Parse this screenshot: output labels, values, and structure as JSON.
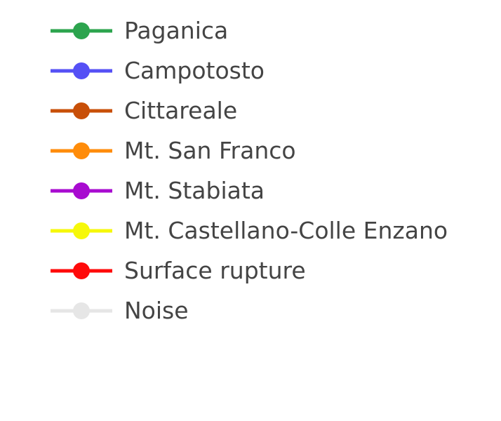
{
  "chart_data": {
    "type": "scatter",
    "legend": [
      {
        "name": "Paganica",
        "color": "#2ca44e"
      },
      {
        "name": "Campotosto",
        "color": "#5550f5"
      },
      {
        "name": "Cittareale",
        "color": "#c84f08"
      },
      {
        "name": "Mt. San Franco",
        "color": "#ff8c0a"
      },
      {
        "name": "Mt. Stabiata",
        "color": "#a80bd0"
      },
      {
        "name": "Mt. Castellano-Colle Enzano",
        "color": "#f6f80a"
      },
      {
        "name": "Surface rupture",
        "color": "#ff0a0a"
      },
      {
        "name": "Noise",
        "color": "#e6e6e6"
      }
    ]
  }
}
